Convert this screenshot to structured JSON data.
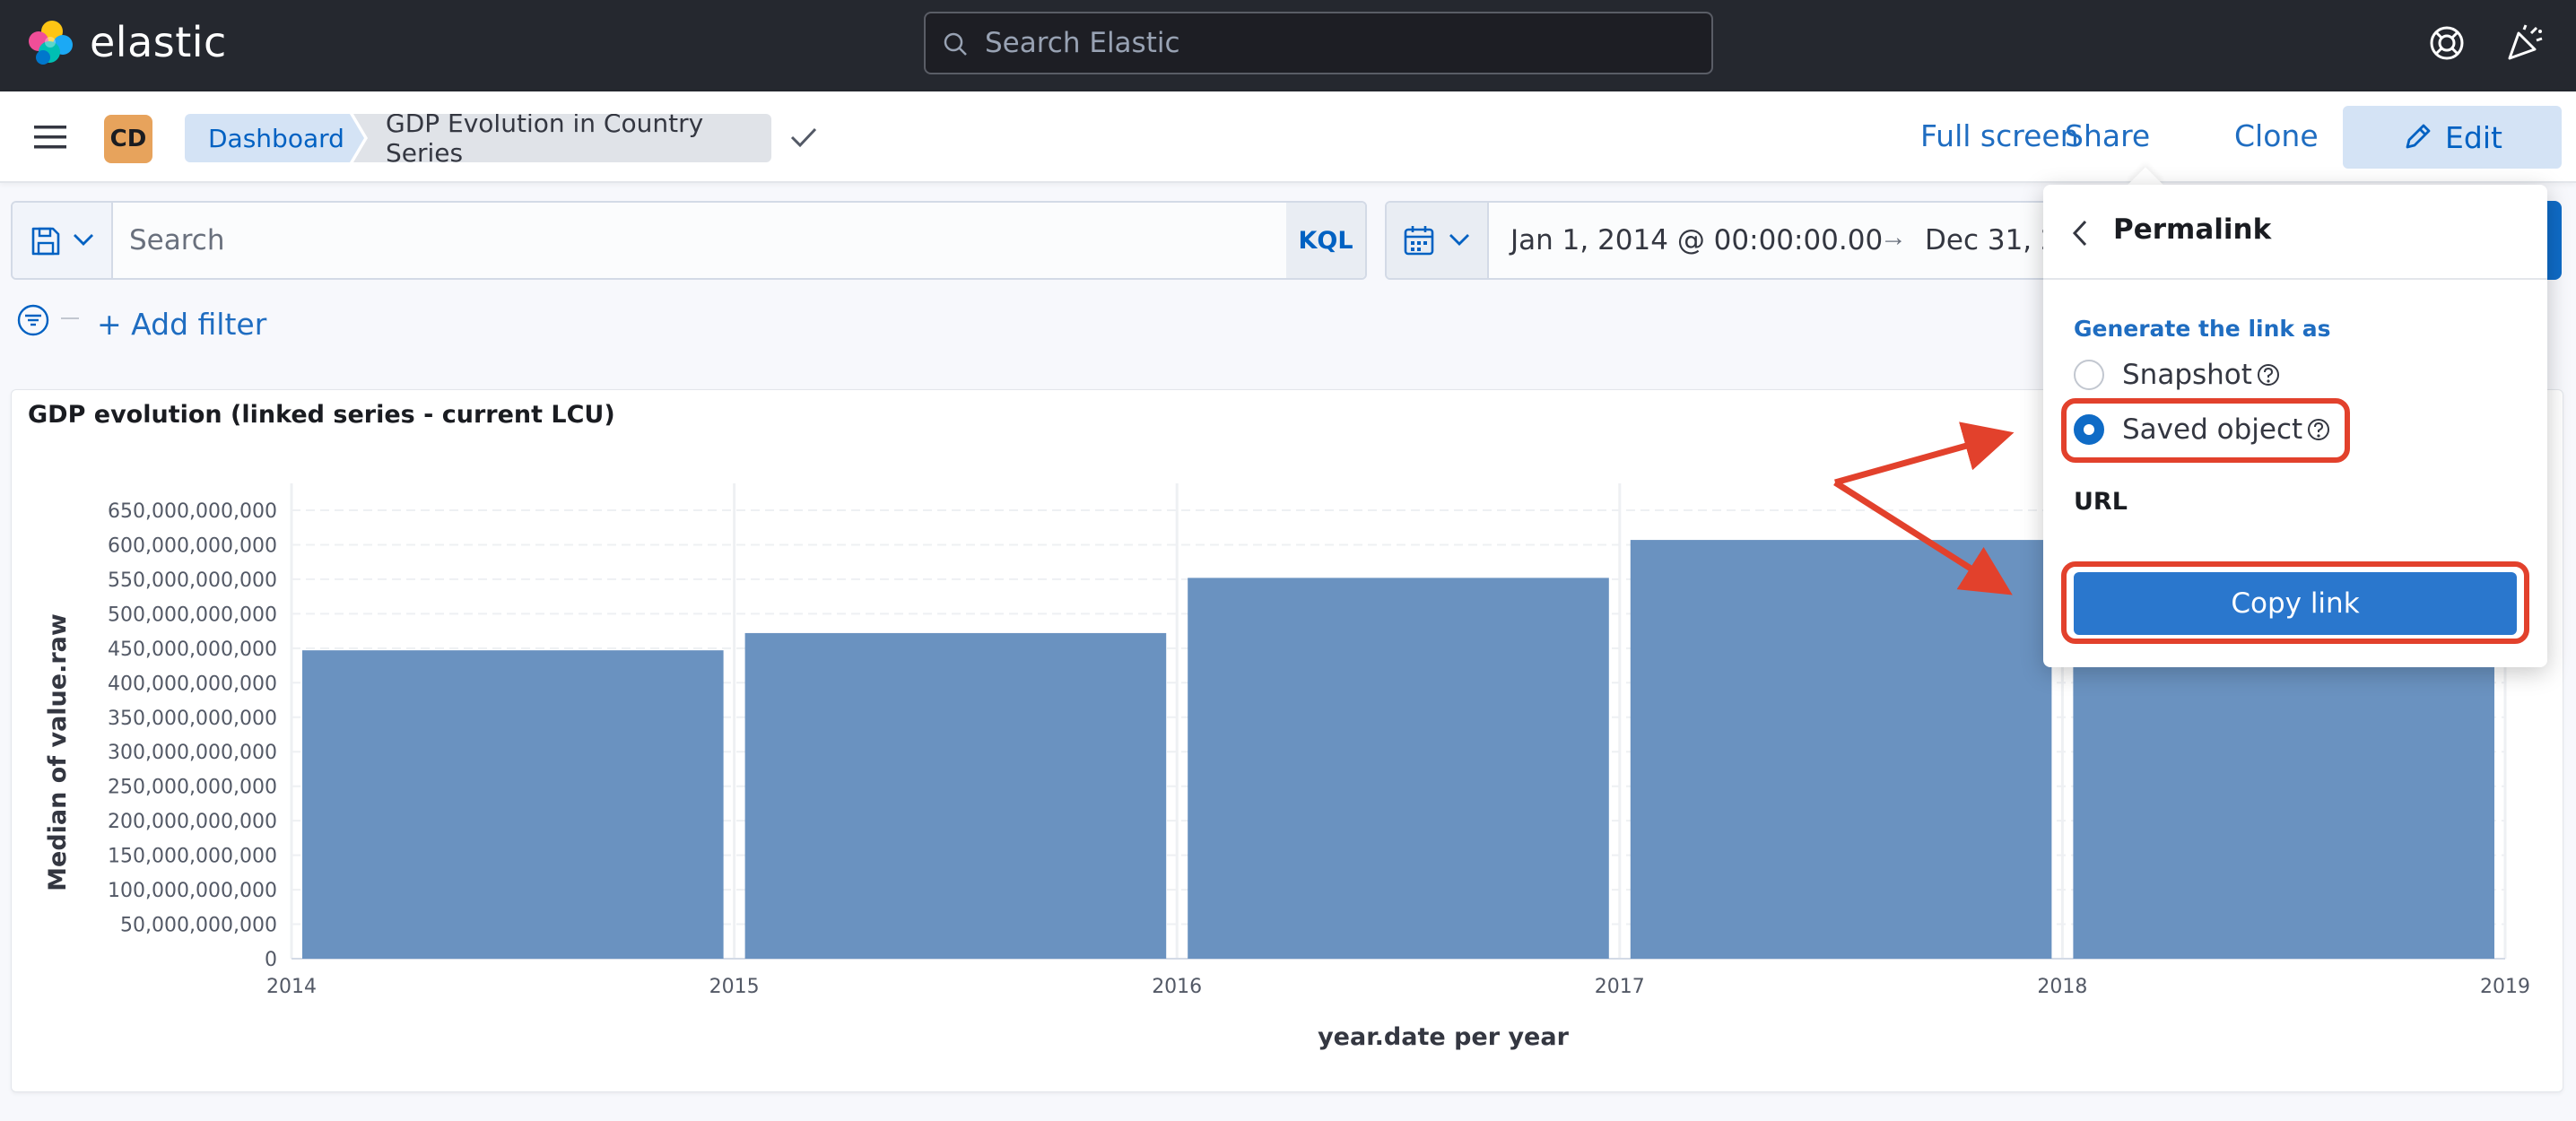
{
  "header": {
    "brand": "elastic",
    "search_placeholder": "Search Elastic"
  },
  "nav": {
    "avatar_initials": "CD",
    "breadcrumbs": [
      "Dashboard",
      "GDP Evolution in Country Series"
    ],
    "full_screen": "Full screen",
    "share": "Share",
    "clone": "Clone",
    "edit": "Edit"
  },
  "query": {
    "placeholder": "Search",
    "language": "KQL"
  },
  "date": {
    "start": "Jan 1, 2014 @ 00:00:00.00",
    "arrow": "→",
    "end": "Dec 31, 2"
  },
  "filter": {
    "add_filter": "+ Add filter"
  },
  "panel": {
    "title": "GDP evolution (linked series - current LCU)"
  },
  "share_popover": {
    "title": "Permalink",
    "generate_label": "Generate the link as",
    "options": [
      {
        "label": "Snapshot",
        "checked": false
      },
      {
        "label": "Saved object",
        "checked": true
      }
    ],
    "url_label": "URL",
    "copy_button": "Copy link"
  },
  "colors": {
    "bar": "#6a92c0",
    "accent": "#0f6bc6",
    "annotation": "#e2412c"
  },
  "chart_data": {
    "type": "bar",
    "ylabel": "Median of value.raw",
    "xlabel": "year.date per year",
    "ylim": [
      0,
      650000000000
    ],
    "yticks": [
      0,
      50000000000,
      100000000000,
      150000000000,
      200000000000,
      250000000000,
      300000000000,
      350000000000,
      400000000000,
      450000000000,
      500000000000,
      550000000000,
      600000000000,
      650000000000
    ],
    "ytick_labels": [
      "0",
      "50,000,000,000",
      "100,000,000,000",
      "150,000,000,000",
      "200,000,000,000",
      "250,000,000,000",
      "300,000,000,000",
      "350,000,000,000",
      "400,000,000,000",
      "450,000,000,000",
      "500,000,000,000",
      "550,000,000,000",
      "600,000,000,000",
      "650,000,000,000"
    ],
    "xtick_labels": [
      "2014",
      "2015",
      "2016",
      "2017",
      "2018",
      "2019"
    ],
    "categories": [
      "2014",
      "2015",
      "2016",
      "2017",
      "2018"
    ],
    "values": [
      447000000000,
      472000000000,
      552000000000,
      607000000000,
      607000000000
    ],
    "grid": true
  }
}
